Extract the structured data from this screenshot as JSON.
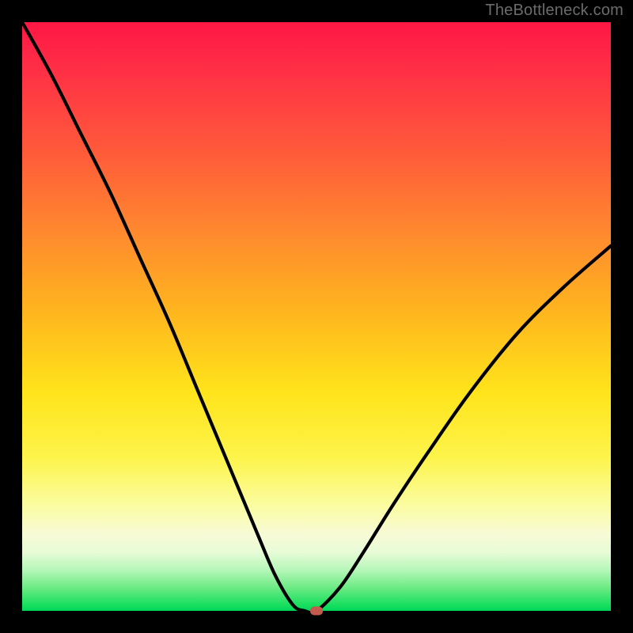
{
  "watermark": "TheBottleneck.com",
  "colors": {
    "frame": "#000000",
    "curve": "#000000",
    "marker": "#c25a4e"
  },
  "chart_data": {
    "type": "line",
    "title": "",
    "xlabel": "",
    "ylabel": "",
    "xlim": [
      0,
      100
    ],
    "ylim": [
      0,
      100
    ],
    "grid": false,
    "legend": false,
    "background_gradient": [
      "#ff1744",
      "#ff8a2e",
      "#ffe41b",
      "#f7fbd6",
      "#00d65a"
    ],
    "series": [
      {
        "name": "curve",
        "x": [
          0,
          5,
          10,
          15,
          20,
          25,
          30,
          35,
          40,
          43,
          46,
          48,
          50,
          54,
          58,
          63,
          69,
          76,
          84,
          92,
          100
        ],
        "values": [
          100,
          91,
          81,
          71,
          60,
          49,
          37,
          25,
          13,
          6,
          1,
          0,
          0,
          4,
          10,
          18,
          27,
          37,
          47,
          55,
          62
        ]
      }
    ],
    "marker": {
      "x": 50,
      "y": 0
    }
  }
}
